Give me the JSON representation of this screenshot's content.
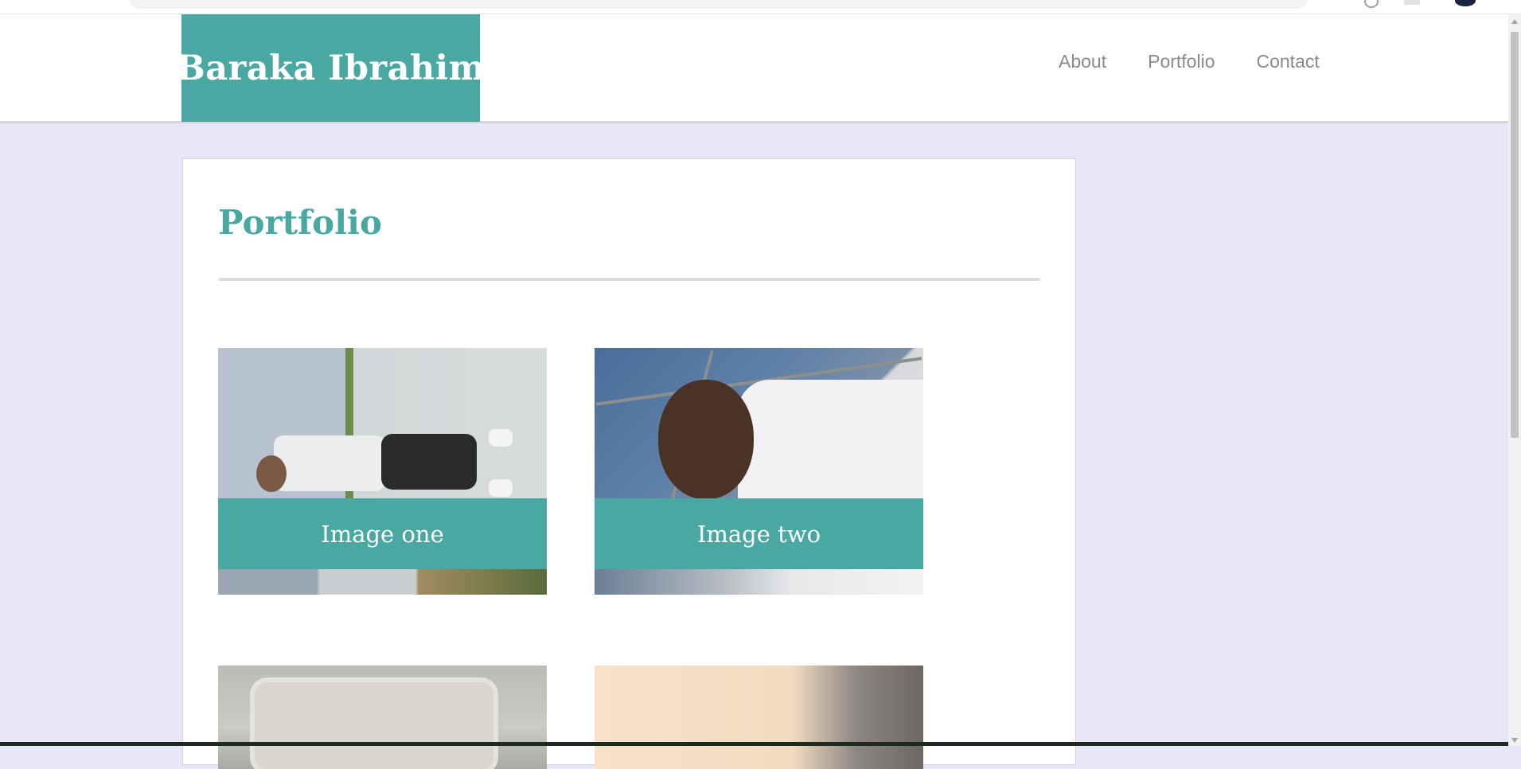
{
  "site": {
    "brand": "Baraka Ibrahim",
    "nav": [
      {
        "label": "About"
      },
      {
        "label": "Portfolio"
      },
      {
        "label": "Contact"
      }
    ]
  },
  "page": {
    "title": "Portfolio"
  },
  "gallery": [
    {
      "caption": "Image one"
    },
    {
      "caption": "Image two"
    },
    {
      "caption": ""
    },
    {
      "caption": ""
    }
  ],
  "colors": {
    "accent": "#4aa8a3",
    "page_background": "#e6e6f8",
    "nav_text": "#8a8a8a"
  }
}
